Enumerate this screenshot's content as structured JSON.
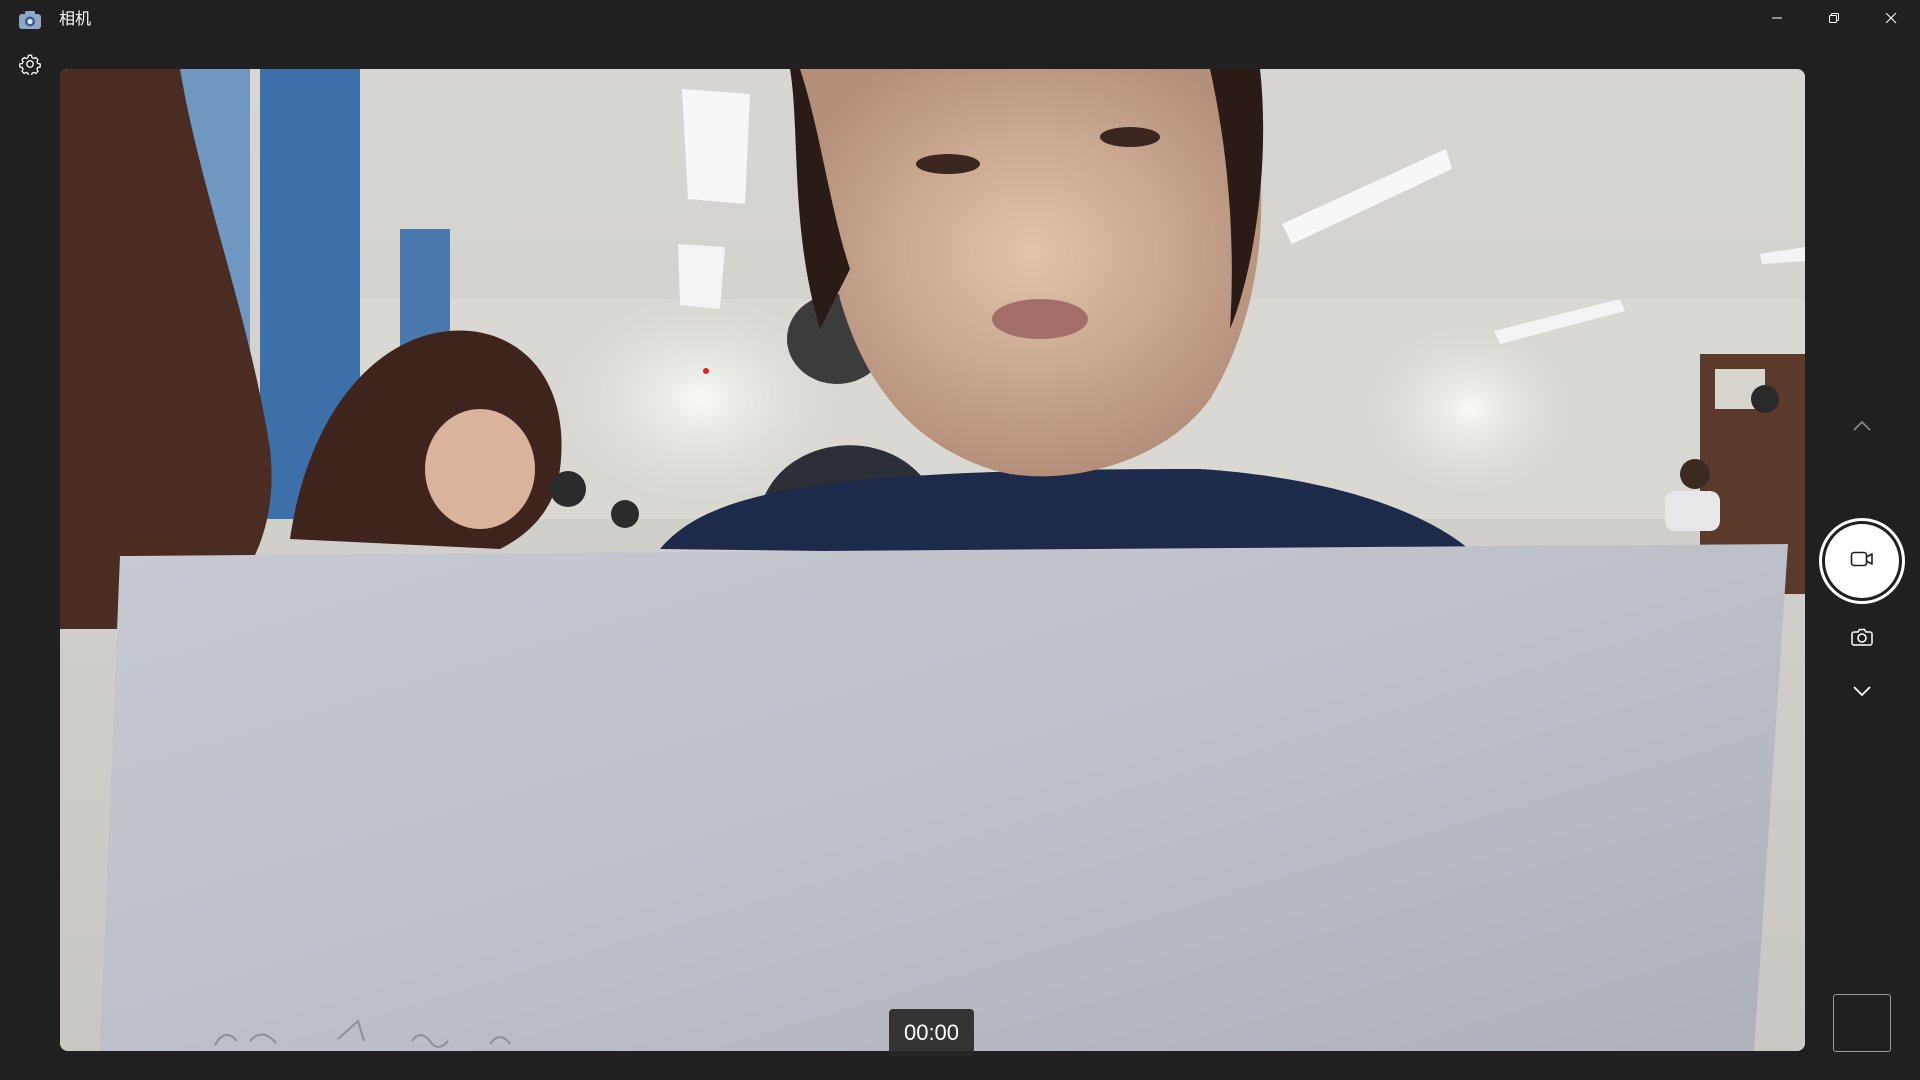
{
  "window": {
    "title": "相机",
    "app_icon": "camera-app-icon",
    "controls": [
      "minimize-icon",
      "restore-icon",
      "close-icon"
    ]
  },
  "toolbar": {
    "settings_icon": "gear-icon"
  },
  "viewfinder": {
    "timer": "00:00",
    "recording_indicator_color": "#e0201c"
  },
  "controls": {
    "mode_up_icon": "chevron-up-icon",
    "record_icon": "video-camera-icon",
    "photo_mode_icon": "camera-icon",
    "mode_down_icon": "chevron-down-icon",
    "thumbnail": "last-capture-thumbnail"
  },
  "colors": {
    "background": "#202020",
    "foreground": "#ffffff"
  }
}
